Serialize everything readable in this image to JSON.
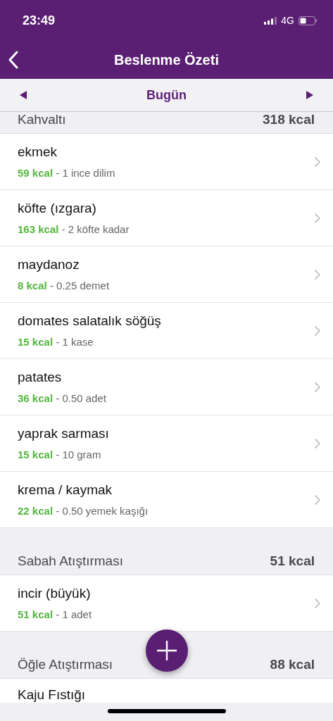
{
  "status_bar": {
    "time": "23:49",
    "network": "4G"
  },
  "nav": {
    "title": "Beslenme Özeti"
  },
  "date_bar": {
    "label": "Bugün"
  },
  "sections": [
    {
      "title": "Kahvaltı",
      "total": "318 kcal",
      "items": [
        {
          "name": "ekmek",
          "kcal": "59 kcal",
          "portion": " - 1 ince dilim"
        },
        {
          "name": "köfte (ızgara)",
          "kcal": "163 kcal",
          "portion": " - 2 köfte kadar"
        },
        {
          "name": "maydanoz",
          "kcal": "8 kcal",
          "portion": " - 0.25 demet"
        },
        {
          "name": "domates salatalık söğüş",
          "kcal": "15 kcal",
          "portion": " - 1 kase"
        },
        {
          "name": "patates",
          "kcal": "36 kcal",
          "portion": " - 0.50 adet"
        },
        {
          "name": "yaprak sarması",
          "kcal": "15 kcal",
          "portion": " - 10 gram"
        },
        {
          "name": "krema / kaymak",
          "kcal": "22 kcal",
          "portion": " - 0.50 yemek kaşığı"
        }
      ]
    },
    {
      "title": "Sabah Atıştırması",
      "total": "51 kcal",
      "items": [
        {
          "name": "incir (büyük)",
          "kcal": "51 kcal",
          "portion": " - 1 adet"
        }
      ]
    },
    {
      "title": "Öğle Atıştırması",
      "total": "88 kcal",
      "items": [
        {
          "name": "Kaju Fıstığı"
        }
      ]
    }
  ]
}
